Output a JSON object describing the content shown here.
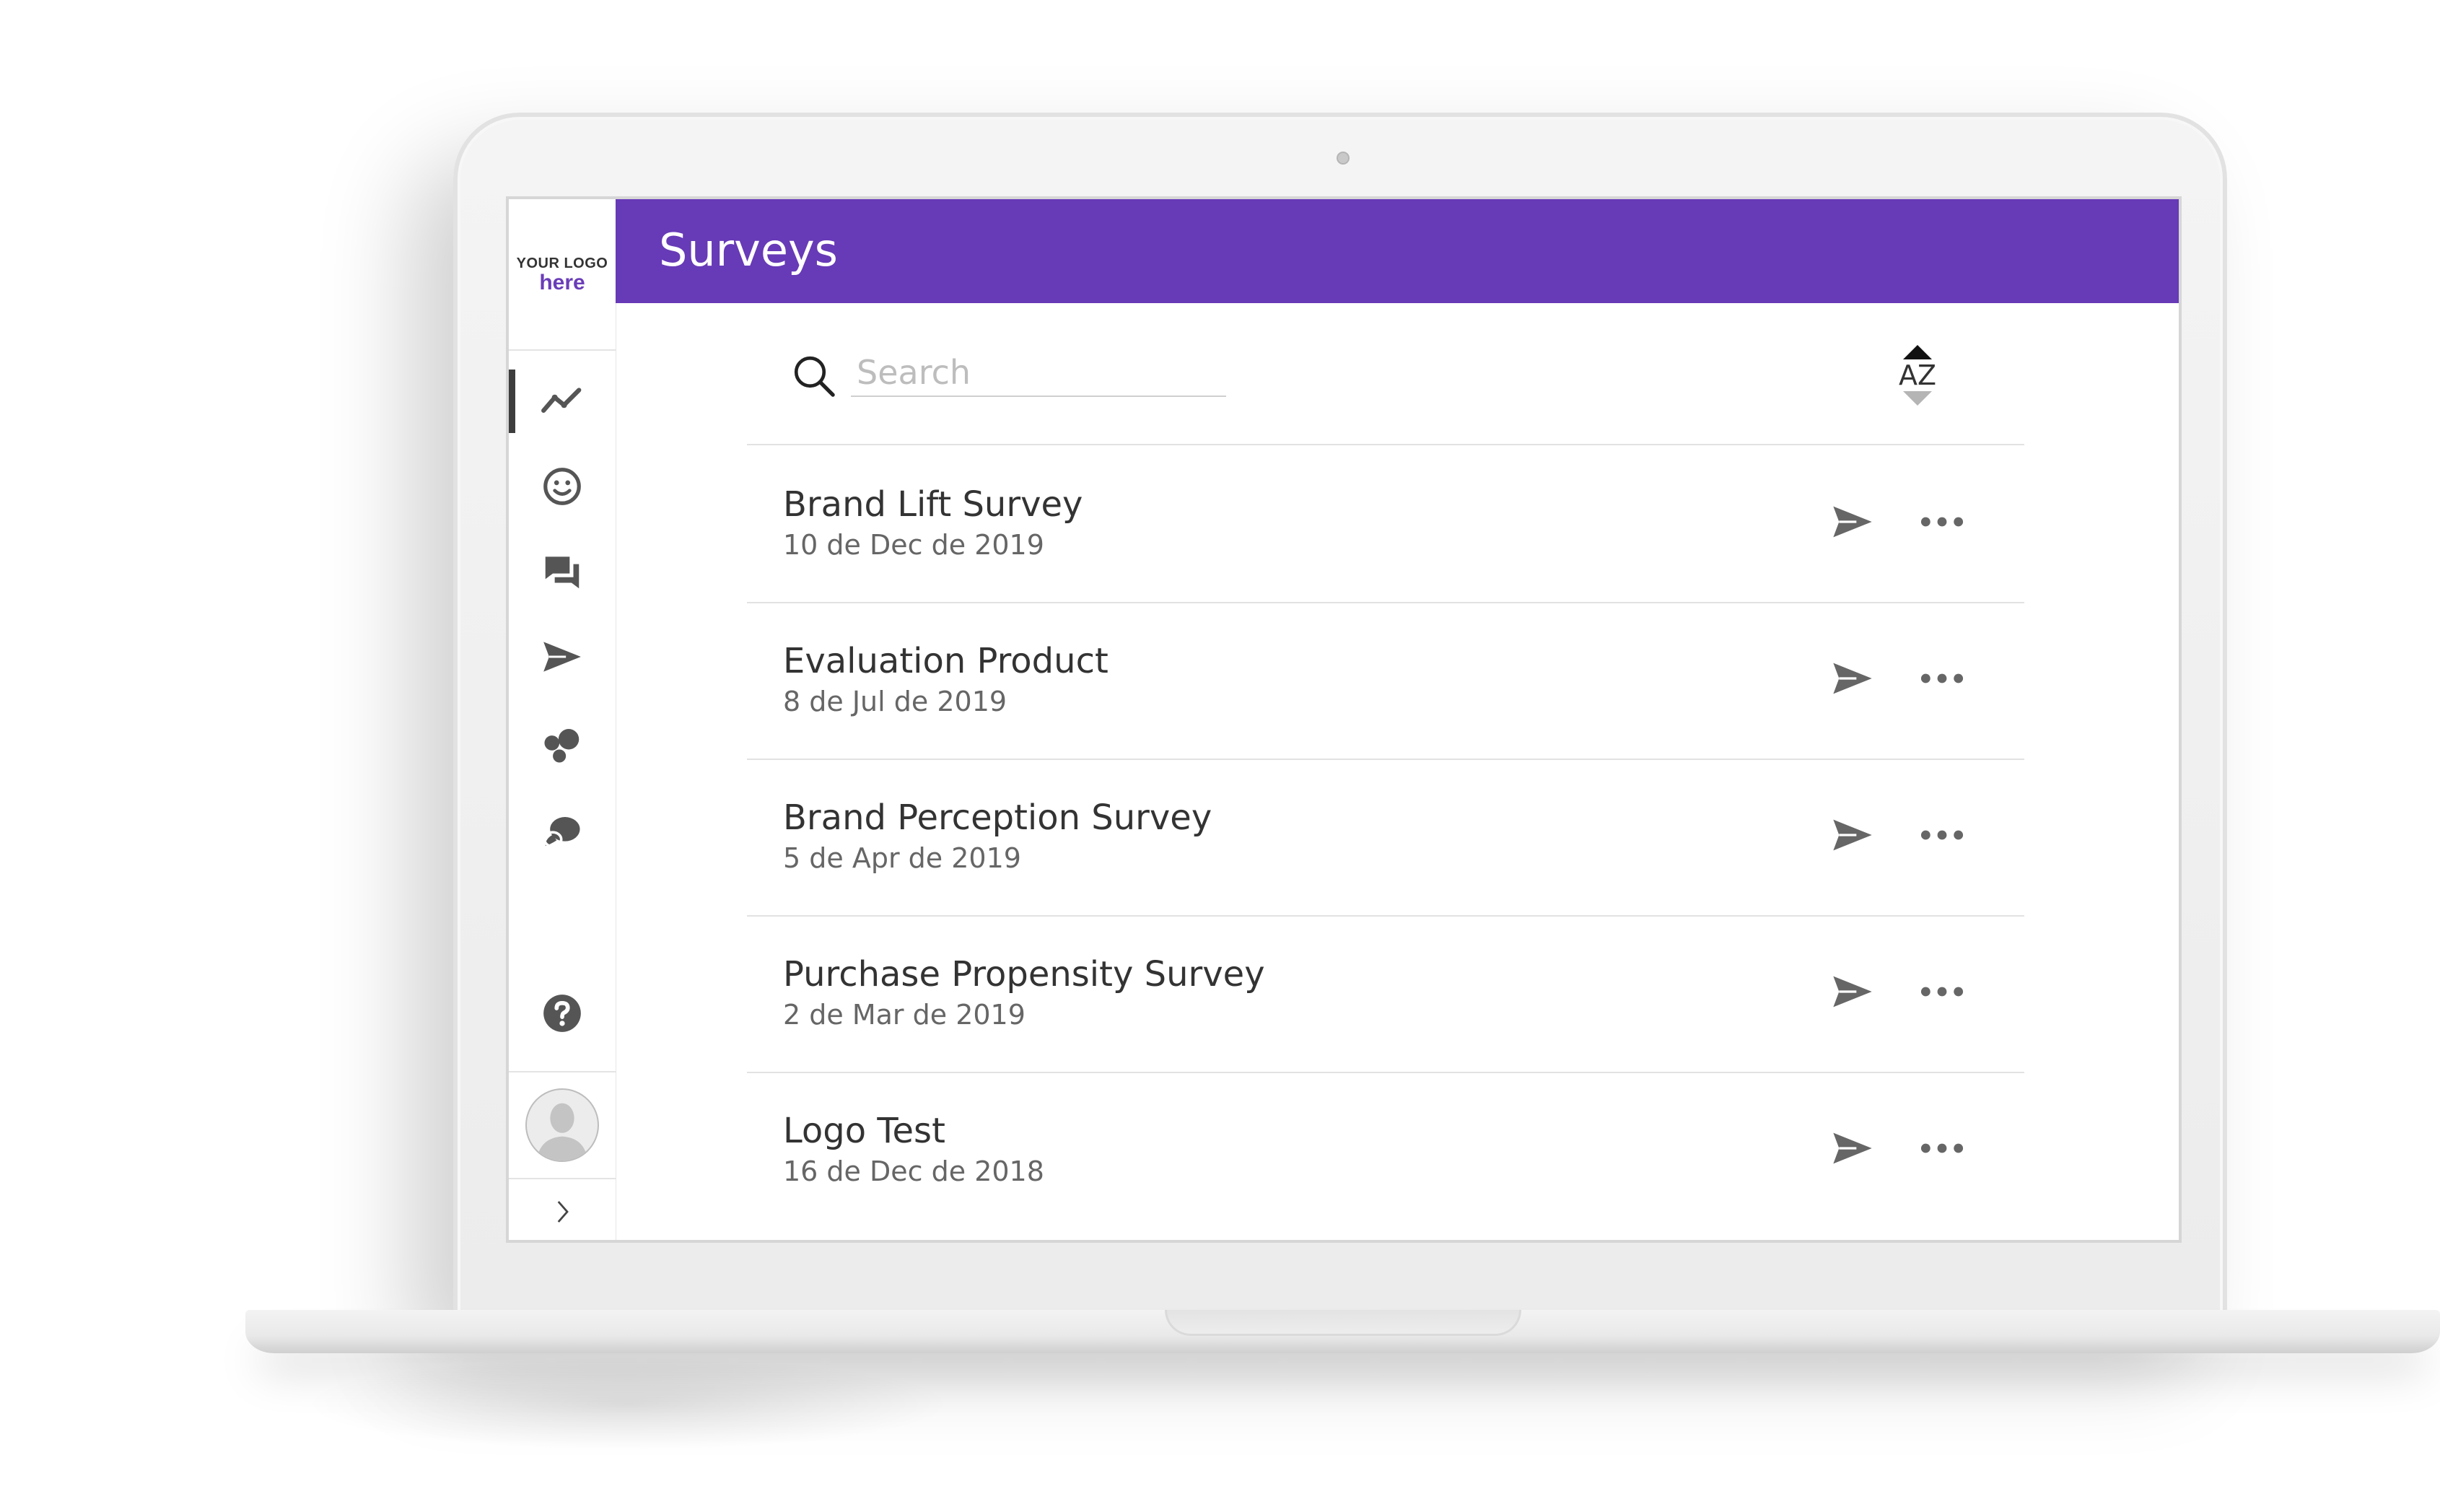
{
  "logo": {
    "line1": "YOUR LOGO",
    "line2": "here"
  },
  "header": {
    "title": "Surveys",
    "accent": "#673ab7"
  },
  "search": {
    "placeholder": "Search",
    "value": ""
  },
  "sort": {
    "label": "AZ"
  },
  "sidebar": {
    "items": [
      {
        "icon": "trend-line-icon",
        "active": true
      },
      {
        "icon": "smiley-icon",
        "active": false
      },
      {
        "icon": "chat-icon",
        "active": false
      },
      {
        "icon": "send-icon",
        "active": false
      },
      {
        "icon": "bubbles-icon",
        "active": false
      },
      {
        "icon": "speech-bubbles-icon",
        "active": false
      }
    ],
    "help_icon": "help-icon",
    "expand_icon": "chevron-right-icon"
  },
  "surveys": [
    {
      "title": "Brand Lift Survey",
      "date": "10 de Dec de 2019"
    },
    {
      "title": "Evaluation Product",
      "date": "8 de Jul de 2019"
    },
    {
      "title": "Brand Perception Survey",
      "date": "5 de Apr de 2019"
    },
    {
      "title": "Purchase Propensity Survey",
      "date": "2 de Mar de 2019"
    },
    {
      "title": "Logo Test",
      "date": "16 de Dec de 2018"
    }
  ]
}
